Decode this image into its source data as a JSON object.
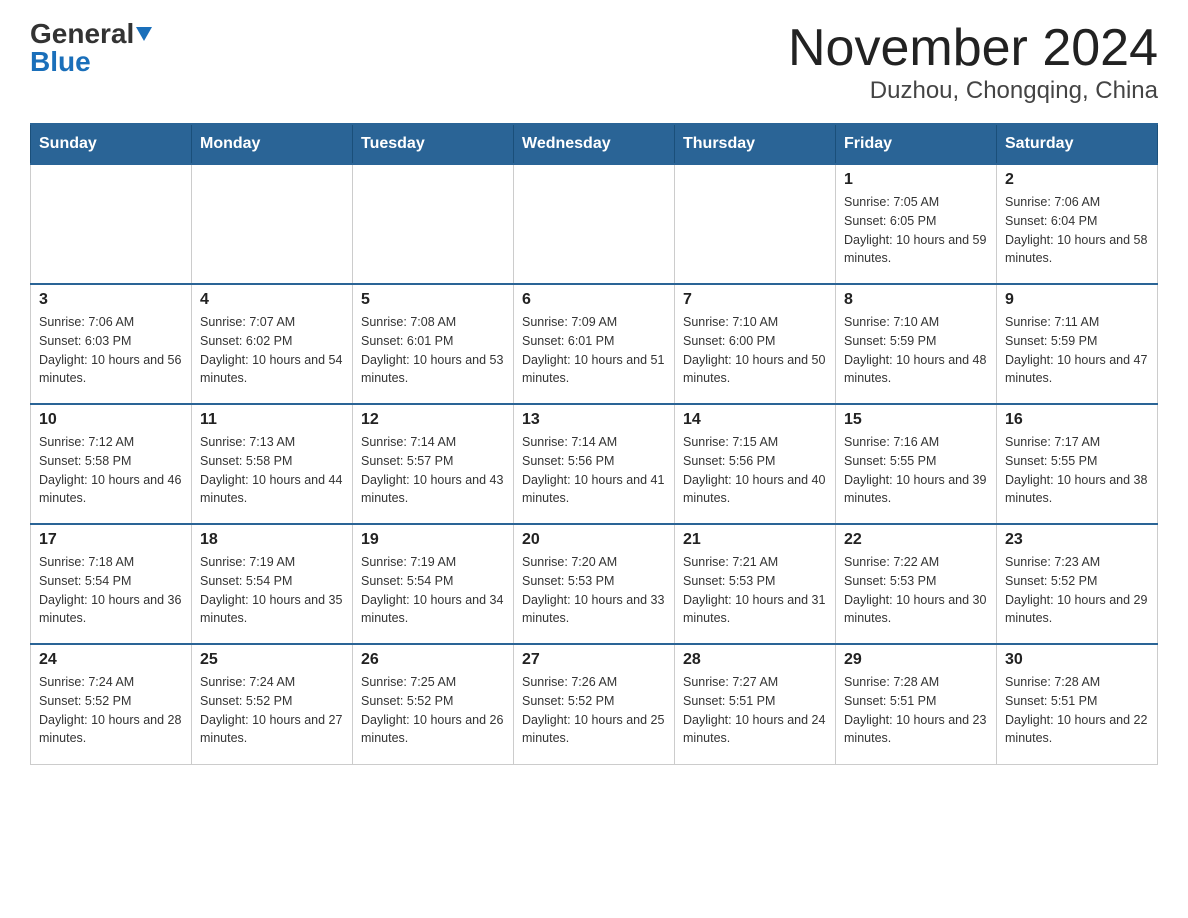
{
  "header": {
    "logo_general": "General",
    "logo_blue": "Blue",
    "title": "November 2024",
    "subtitle": "Duzhou, Chongqing, China"
  },
  "days_of_week": [
    "Sunday",
    "Monday",
    "Tuesday",
    "Wednesday",
    "Thursday",
    "Friday",
    "Saturday"
  ],
  "weeks": [
    [
      {
        "day": "",
        "info": ""
      },
      {
        "day": "",
        "info": ""
      },
      {
        "day": "",
        "info": ""
      },
      {
        "day": "",
        "info": ""
      },
      {
        "day": "",
        "info": ""
      },
      {
        "day": "1",
        "info": "Sunrise: 7:05 AM\nSunset: 6:05 PM\nDaylight: 10 hours and 59 minutes."
      },
      {
        "day": "2",
        "info": "Sunrise: 7:06 AM\nSunset: 6:04 PM\nDaylight: 10 hours and 58 minutes."
      }
    ],
    [
      {
        "day": "3",
        "info": "Sunrise: 7:06 AM\nSunset: 6:03 PM\nDaylight: 10 hours and 56 minutes."
      },
      {
        "day": "4",
        "info": "Sunrise: 7:07 AM\nSunset: 6:02 PM\nDaylight: 10 hours and 54 minutes."
      },
      {
        "day": "5",
        "info": "Sunrise: 7:08 AM\nSunset: 6:01 PM\nDaylight: 10 hours and 53 minutes."
      },
      {
        "day": "6",
        "info": "Sunrise: 7:09 AM\nSunset: 6:01 PM\nDaylight: 10 hours and 51 minutes."
      },
      {
        "day": "7",
        "info": "Sunrise: 7:10 AM\nSunset: 6:00 PM\nDaylight: 10 hours and 50 minutes."
      },
      {
        "day": "8",
        "info": "Sunrise: 7:10 AM\nSunset: 5:59 PM\nDaylight: 10 hours and 48 minutes."
      },
      {
        "day": "9",
        "info": "Sunrise: 7:11 AM\nSunset: 5:59 PM\nDaylight: 10 hours and 47 minutes."
      }
    ],
    [
      {
        "day": "10",
        "info": "Sunrise: 7:12 AM\nSunset: 5:58 PM\nDaylight: 10 hours and 46 minutes."
      },
      {
        "day": "11",
        "info": "Sunrise: 7:13 AM\nSunset: 5:58 PM\nDaylight: 10 hours and 44 minutes."
      },
      {
        "day": "12",
        "info": "Sunrise: 7:14 AM\nSunset: 5:57 PM\nDaylight: 10 hours and 43 minutes."
      },
      {
        "day": "13",
        "info": "Sunrise: 7:14 AM\nSunset: 5:56 PM\nDaylight: 10 hours and 41 minutes."
      },
      {
        "day": "14",
        "info": "Sunrise: 7:15 AM\nSunset: 5:56 PM\nDaylight: 10 hours and 40 minutes."
      },
      {
        "day": "15",
        "info": "Sunrise: 7:16 AM\nSunset: 5:55 PM\nDaylight: 10 hours and 39 minutes."
      },
      {
        "day": "16",
        "info": "Sunrise: 7:17 AM\nSunset: 5:55 PM\nDaylight: 10 hours and 38 minutes."
      }
    ],
    [
      {
        "day": "17",
        "info": "Sunrise: 7:18 AM\nSunset: 5:54 PM\nDaylight: 10 hours and 36 minutes."
      },
      {
        "day": "18",
        "info": "Sunrise: 7:19 AM\nSunset: 5:54 PM\nDaylight: 10 hours and 35 minutes."
      },
      {
        "day": "19",
        "info": "Sunrise: 7:19 AM\nSunset: 5:54 PM\nDaylight: 10 hours and 34 minutes."
      },
      {
        "day": "20",
        "info": "Sunrise: 7:20 AM\nSunset: 5:53 PM\nDaylight: 10 hours and 33 minutes."
      },
      {
        "day": "21",
        "info": "Sunrise: 7:21 AM\nSunset: 5:53 PM\nDaylight: 10 hours and 31 minutes."
      },
      {
        "day": "22",
        "info": "Sunrise: 7:22 AM\nSunset: 5:53 PM\nDaylight: 10 hours and 30 minutes."
      },
      {
        "day": "23",
        "info": "Sunrise: 7:23 AM\nSunset: 5:52 PM\nDaylight: 10 hours and 29 minutes."
      }
    ],
    [
      {
        "day": "24",
        "info": "Sunrise: 7:24 AM\nSunset: 5:52 PM\nDaylight: 10 hours and 28 minutes."
      },
      {
        "day": "25",
        "info": "Sunrise: 7:24 AM\nSunset: 5:52 PM\nDaylight: 10 hours and 27 minutes."
      },
      {
        "day": "26",
        "info": "Sunrise: 7:25 AM\nSunset: 5:52 PM\nDaylight: 10 hours and 26 minutes."
      },
      {
        "day": "27",
        "info": "Sunrise: 7:26 AM\nSunset: 5:52 PM\nDaylight: 10 hours and 25 minutes."
      },
      {
        "day": "28",
        "info": "Sunrise: 7:27 AM\nSunset: 5:51 PM\nDaylight: 10 hours and 24 minutes."
      },
      {
        "day": "29",
        "info": "Sunrise: 7:28 AM\nSunset: 5:51 PM\nDaylight: 10 hours and 23 minutes."
      },
      {
        "day": "30",
        "info": "Sunrise: 7:28 AM\nSunset: 5:51 PM\nDaylight: 10 hours and 22 minutes."
      }
    ]
  ]
}
